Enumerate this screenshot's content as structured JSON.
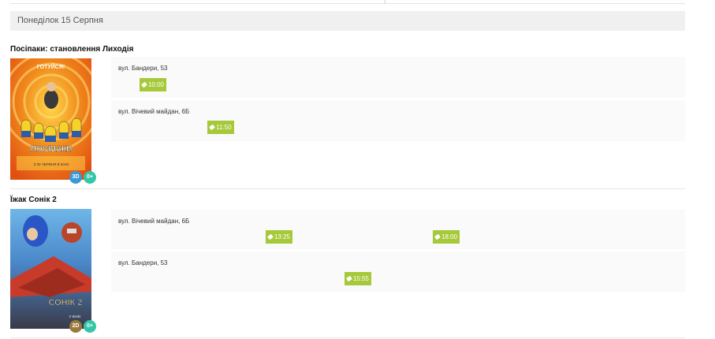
{
  "date_label": "Понеділок 15 Серпня",
  "movies": [
    {
      "title": "Посіпаки: становлення Лиходія",
      "poster": {
        "top_text": "ГОТУЙСЯ!",
        "logo_text": "ПОСІПАКИ",
        "sub_text": "З 30 ЧЕРВНЯ В КІНО"
      },
      "badges": [
        "3D",
        "0+"
      ],
      "badge_colors": [
        "#3a9ad9",
        "#34c6a8"
      ],
      "venues": [
        {
          "name": "вул. Бандери, 53",
          "times": [
            "10:00"
          ]
        },
        {
          "name": "вул. Вічевий майдан, 6Б",
          "times": [
            "11:50"
          ]
        }
      ]
    },
    {
      "title": "Їжак Сонік 2",
      "poster": {
        "logo_text": "СОНІК 2",
        "sub_text": "У КІНО"
      },
      "badges": [
        "2D",
        "0+"
      ],
      "badge_colors": [
        "#9a7a3c",
        "#34c6a8"
      ],
      "venues": [
        {
          "name": "вул. Вічевий майдан, 6Б",
          "times": [
            "13:25",
            "18:00"
          ]
        },
        {
          "name": "вул. Бандери, 53",
          "times": [
            "15:55"
          ]
        }
      ]
    }
  ],
  "accent_color": "#a6c93a"
}
